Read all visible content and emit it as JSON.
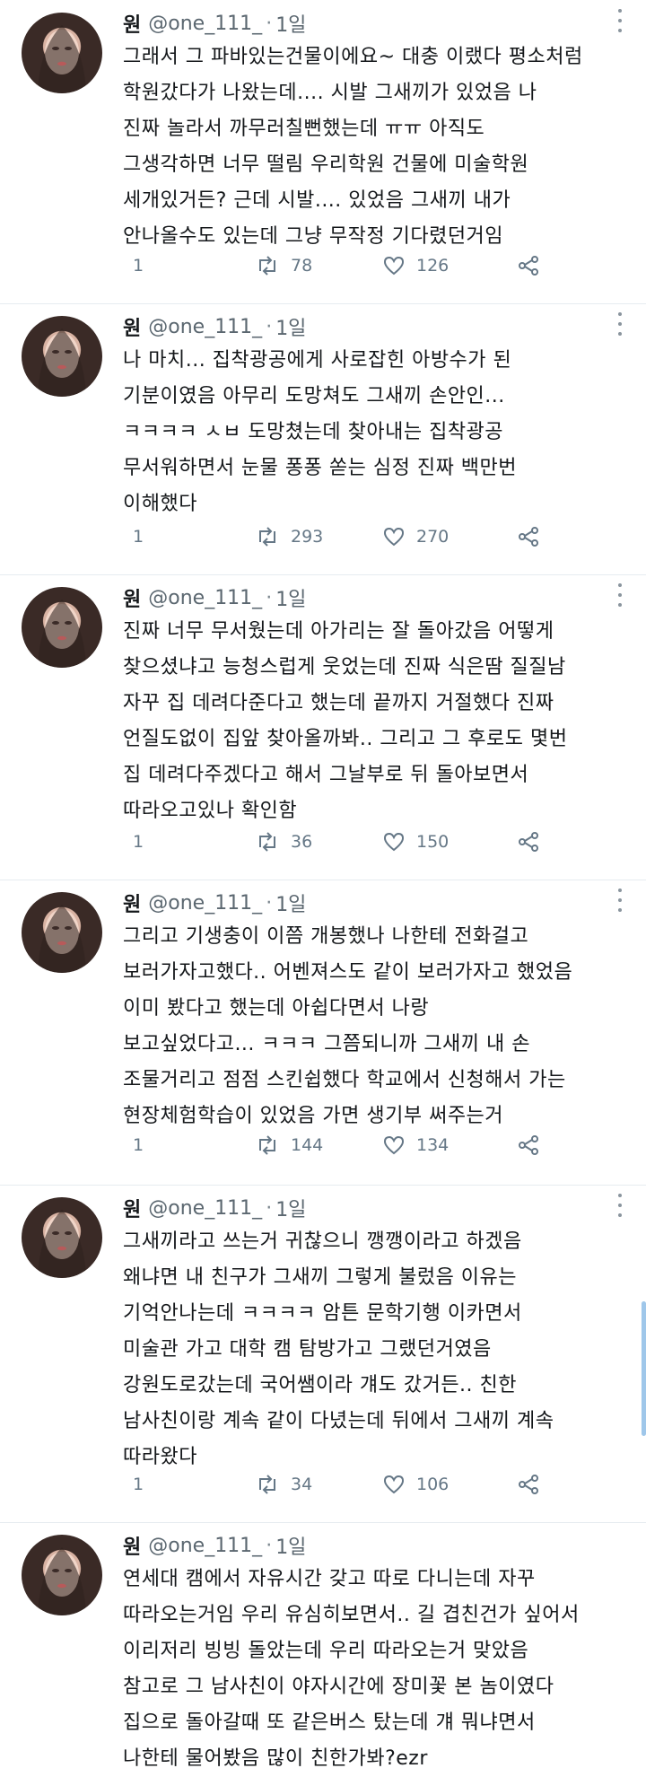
{
  "tweets": [
    {
      "name": "원",
      "handle": "@one_111_",
      "time": "1일",
      "lines": [
        "그래서 그 파바있는건물이에요~ 대충 이랬다 평소처럼",
        "학원갔다가 나왔는데.... 시발 그새끼가 있었음 나",
        "진짜 놀라서 까무러칠뻔했는데 ㅠㅠ 아직도",
        "그생각하면 너무 떨림 우리학원 건물에 미술학원",
        "세개있거든? 근데 시발.... 있었음 그새끼 내가",
        "안나올수도 있는데 그냥 무작정 기다렸던거임"
      ],
      "replies": "1",
      "retweets": "78",
      "likes": "126"
    },
    {
      "name": "원",
      "handle": "@one_111_",
      "time": "1일",
      "lines": [
        "나 마치... 집착광공에게 사로잡힌 아방수가 된",
        "기분이였음 아무리 도망쳐도 그새끼 손안인...",
        "ㅋㅋㅋㅋ ㅅㅂ 도망쳤는데 찾아내는 집착광공",
        "무서워하면서 눈물 퐁퐁 쏟는 심정 진짜 백만번",
        "이해했다"
      ],
      "replies": "1",
      "retweets": "293",
      "likes": "270"
    },
    {
      "name": "원",
      "handle": "@one_111_",
      "time": "1일",
      "lines": [
        "진짜 너무 무서웠는데 아가리는 잘 돌아갔음 어떻게",
        "찾으셨냐고 능청스럽게 웃었는데 진짜 식은땀 질질남",
        "자꾸 집 데려다준다고 했는데 끝까지 거절했다 진짜",
        "언질도없이 집앞 찾아올까봐.. 그리고 그 후로도 몇번",
        "집 데려다주겠다고 해서 그날부로 뒤 돌아보면서",
        "따라오고있나 확인함"
      ],
      "replies": "1",
      "retweets": "36",
      "likes": "150"
    },
    {
      "name": "원",
      "handle": "@one_111_",
      "time": "1일",
      "lines": [
        "그리고 기생충이 이쯤 개봉했나 나한테 전화걸고",
        "보러가자고했다.. 어벤져스도 같이 보러가자고 했었음",
        "이미 봤다고 했는데 아쉽다면서 나랑",
        "보고싶었다고... ㅋㅋㅋ 그쯤되니까 그새끼 내 손",
        "조물거리고 점점 스킨쉽했다 학교에서 신청해서 가는",
        "현장체험학습이 있었음 가면 생기부 써주는거"
      ],
      "replies": "1",
      "retweets": "144",
      "likes": "134"
    },
    {
      "name": "원",
      "handle": "@one_111_",
      "time": "1일",
      "lines": [
        "그새끼라고 쓰는거 귀찮으니 깽깽이라고 하겠음",
        "왜냐면 내 친구가 그새끼 그렇게 불렀음 이유는",
        "기억안나는데 ㅋㅋㅋㅋ 암튼 문학기행 이카면서",
        "미술관 가고 대학 캠 탐방가고 그랬던거였음",
        "강원도로갔는데 국어쌤이라 걔도 갔거든.. 친한",
        "남사친이랑 계속 같이 다녔는데 뒤에서 그새끼 계속",
        "따라왔다"
      ],
      "replies": "1",
      "retweets": "34",
      "likes": "106"
    },
    {
      "name": "원",
      "handle": "@one_111_",
      "time": "1일",
      "lines": [
        "연세대 캠에서 자유시간 갖고 따로 다니는데 자꾸",
        "따라오는거임 우리 유심히보면서.. 길 겹친건가 싶어서",
        "이리저리 빙빙 돌았는데 우리 따라오는거 맞았음",
        "참고로 그 남사친이 야자시간에 장미꽃 본 놈이였다",
        "집으로 돌아갈때 또 같은버스 탔는데 걔 뭐냐면서",
        "나한테 물어봤음 많이 친한가봐?ezr"
      ]
    }
  ]
}
